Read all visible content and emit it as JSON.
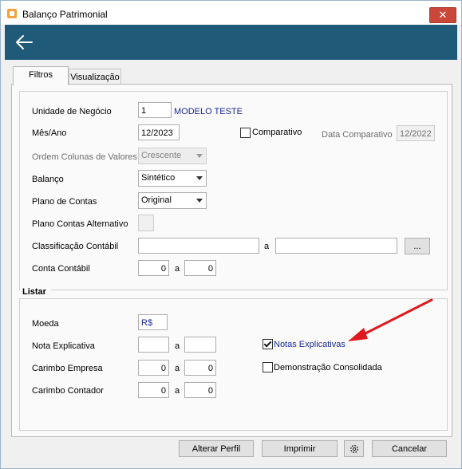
{
  "window": {
    "title": "Balanço Patrimonial",
    "close_glyph": "✕",
    "icon": "app-icon"
  },
  "tabs": [
    {
      "label": "Filtros",
      "active": true
    },
    {
      "label": "Visualização",
      "active": false
    }
  ],
  "filters": {
    "unidade_label": "Unidade de Negócio",
    "unidade_code": "1",
    "unidade_name": "MODELO TESTE",
    "mesano_label": "Mês/Ano",
    "mesano_value": "12/2023",
    "comparativo_label": "Comparativo",
    "comparativo_checked": false,
    "data_comparativo_label": "Data Comparativo",
    "data_comparativo_value": "12/2022",
    "ordem_label": "Ordem Colunas de Valores",
    "ordem_value": "Crescente",
    "balanco_label": "Balanço",
    "balanco_value": "Sintético",
    "plano_label": "Plano de Contas",
    "plano_value": "Original",
    "plano_alt_label": "Plano Contas Alternativo",
    "classificacao_label": "Classificação Contábil",
    "classificacao_from": "",
    "classificacao_sep": "a",
    "classificacao_to": "",
    "browse_label": "...",
    "conta_label": "Conta Contábil",
    "conta_from": "0",
    "conta_sep": "a",
    "conta_to": "0"
  },
  "listar": {
    "title": "Listar",
    "moeda_label": "Moeda",
    "moeda_value": "R$",
    "nota_label": "Nota Explicativa",
    "nota_from": "",
    "nota_sep": "a",
    "nota_to": "",
    "carimbo_emp_label": "Carimbo Empresa",
    "carimbo_emp_from": "0",
    "carimbo_emp_sep": "a",
    "carimbo_emp_to": "0",
    "carimbo_cont_label": "Carimbo Contador",
    "carimbo_cont_from": "0",
    "carimbo_cont_sep": "a",
    "carimbo_cont_to": "0",
    "notas_label": "Notas Explicativas",
    "notas_checked": true,
    "demonstracao_label": "Demonstração Consolidada",
    "demonstracao_checked": false
  },
  "footer": {
    "alterar_label": "Alterar Perfil",
    "imprimir_label": "Imprimir",
    "cancelar_label": "Cancelar"
  },
  "colors": {
    "header": "#1f5a78",
    "close": "#c9483a",
    "link_blue": "#1a2a9a",
    "annotation_arrow": "#e0191e"
  }
}
